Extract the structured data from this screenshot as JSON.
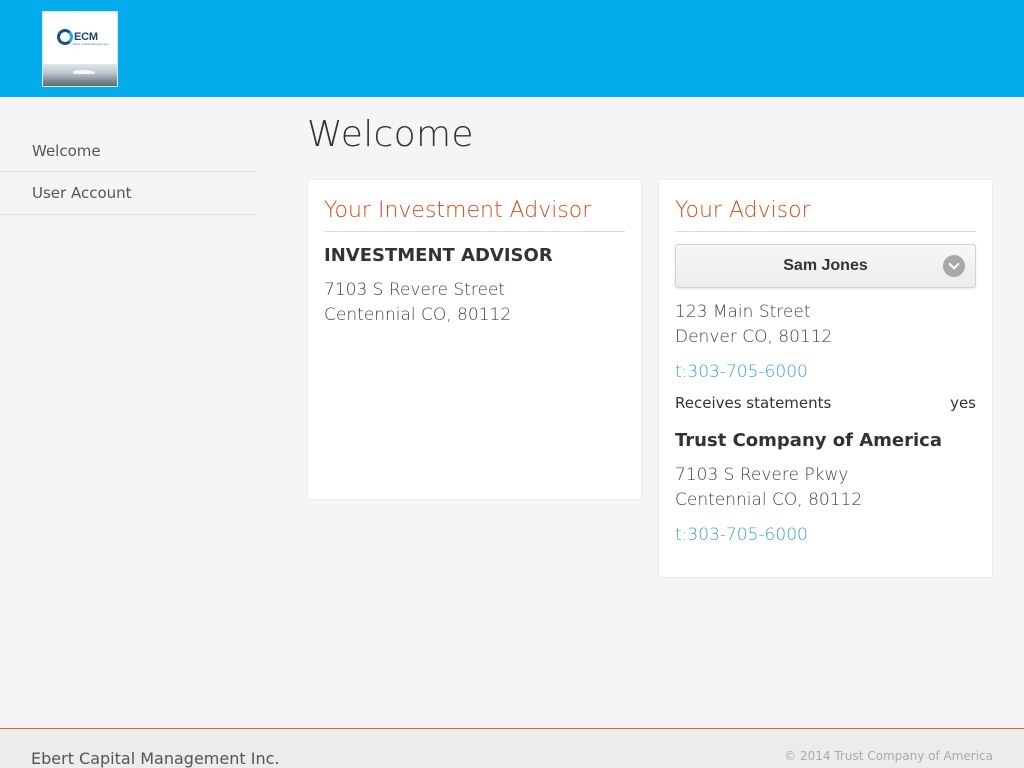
{
  "header": {
    "logo_text": "ECM",
    "logo_sub": "Ebert Capital Management",
    "brand_color": "#02aced"
  },
  "sidebar": {
    "items": [
      {
        "label": "Welcome"
      },
      {
        "label": "User Account"
      }
    ]
  },
  "main": {
    "title": "Welcome",
    "investment_advisor": {
      "heading": "Your Investment Advisor",
      "name": "INVESTMENT ADVISOR",
      "address_line1": "7103 S Revere Street",
      "address_line2": "Centennial CO, 80112"
    },
    "advisor": {
      "heading": "Your Advisor",
      "selected": "Sam Jones",
      "address_line1": "123 Main Street",
      "address_line2": "Denver CO, 80112",
      "phone": "t:303-705-6000",
      "statements_label": "Receives statements",
      "statements_value": "yes",
      "custodian_name": "Trust Company of America",
      "custodian_address_line1": "7103 S Revere Pkwy",
      "custodian_address_line2": "Centennial CO, 80112",
      "custodian_phone": "t:303-705-6000"
    },
    "accent_color": "#d14d1b",
    "link_color": "#3a9fd1"
  },
  "footer": {
    "company": "Ebert Capital Management Inc.",
    "copyright": "© 2014 Trust Company of America"
  }
}
